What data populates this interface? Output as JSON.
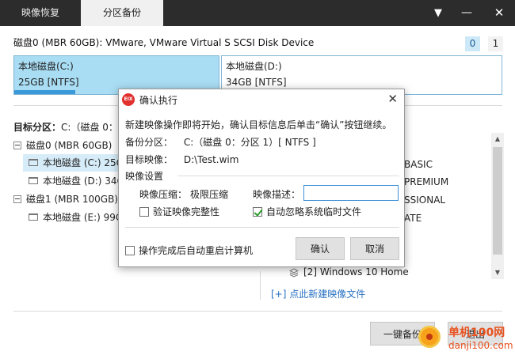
{
  "tabs": {
    "recover": "映像恢复",
    "partition_backup": "分区备份"
  },
  "window_buttons": {
    "menu": "▼",
    "minimize": "—",
    "close": "✕"
  },
  "disk_header": {
    "title": "磁盘0 (MBR 60GB): VMware, VMware Virtual S SCSI Disk Device",
    "disk_numbers": [
      "0",
      "1"
    ]
  },
  "partitions": [
    {
      "name": "本地磁盘(C:)",
      "size": "25GB [NTFS]",
      "used_fraction": 0.3
    },
    {
      "name": "本地磁盘(D:)",
      "size": "34GB [NTFS]"
    }
  ],
  "target": {
    "label": "目标分区：",
    "value": "C:（磁盘 0："
  },
  "tree": [
    {
      "text": "磁盘0 (MBR 60GB)",
      "kind": "disk"
    },
    {
      "text": "本地磁盘 (C:) 25G",
      "kind": "partition",
      "selected": true
    },
    {
      "text": "本地磁盘 (D:) 34G",
      "kind": "partition"
    },
    {
      "text": "磁盘1 (MBR 100GB)",
      "kind": "disk"
    },
    {
      "text": "本地磁盘 (E:) 99G",
      "kind": "partition"
    }
  ],
  "editions": [
    "BASIC",
    "PREMIUM",
    "SSIONAL",
    "ATE"
  ],
  "image_entry": "[2] Windows 10 Home",
  "add_image_link": "[+] 点此新建映像文件",
  "main_buttons": {
    "start": "一键备份",
    "exit": "退出"
  },
  "dialog": {
    "title": "确认执行",
    "logo_text": "EIX",
    "message": "新建映像操作即将开始，确认目标信息后单击“确认”按钮继续。",
    "backup_partition_label": "备份分区：",
    "backup_partition_value": "C:（磁盘 0：分区 1）[ NTFS ]",
    "target_image_label": "目标映像：",
    "target_image_value": "D:\\Test.wim",
    "settings_heading": "映像设置",
    "compression_label": "映像压缩：",
    "compression_value": "极限压缩",
    "description_label": "映像描述：",
    "description_value": "",
    "verify_label": "验证映像完整性",
    "verify_checked": false,
    "ignore_temp_label": "自动忽略系统临时文件",
    "ignore_temp_checked": true,
    "restart_label": "操作完成后自动重启计算机",
    "restart_checked": false,
    "ok": "确认",
    "cancel": "取消"
  },
  "watermark": {
    "cn": "单机100网",
    "en": "danji100.com"
  },
  "colors": {
    "accent": "#3a9ad9",
    "selected_partition": "#a9ddf4",
    "link": "#2a72c2",
    "logo": "#e0312f"
  }
}
